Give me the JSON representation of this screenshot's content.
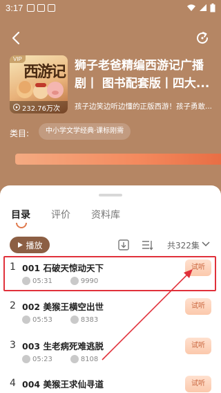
{
  "status_bar": {
    "time": "3:17"
  },
  "album": {
    "vip_badge": "VIP",
    "art_title": "西游记",
    "play_count": "232.76万次"
  },
  "book": {
    "title": "狮子老爸精编西游记广播剧丨 图书配套版丨四大...",
    "subtitle": "孩子边笑边听边懂的正版西游！孩子勇敢..."
  },
  "category": {
    "label": "类目:",
    "tag": "中小学文学经典·课标刚需"
  },
  "tabs": [
    {
      "label": "目录"
    },
    {
      "label": "评价"
    },
    {
      "label": "资料库"
    }
  ],
  "toolbar": {
    "play_label": "播放",
    "total": "共322集"
  },
  "episodes": [
    {
      "index": "1",
      "title": "001 石破天惊动天下",
      "duration": "05:31",
      "plays": "9990",
      "trial": "试听"
    },
    {
      "index": "2",
      "title": "002 美猴王横空出世",
      "duration": "05:53",
      "plays": "8383",
      "trial": "试听"
    },
    {
      "index": "3",
      "title": "003 生老病死难逃脱",
      "duration": "05:23",
      "plays": "8108",
      "trial": "试听"
    },
    {
      "index": "4",
      "title": "004 美猴王求仙寻道",
      "duration": "",
      "plays": "",
      "trial": "试听"
    }
  ],
  "colors": {
    "header_bg": "#b58664",
    "accent": "#e07a4d",
    "play_button": "#8c5f44",
    "highlight": "#e0303a"
  }
}
